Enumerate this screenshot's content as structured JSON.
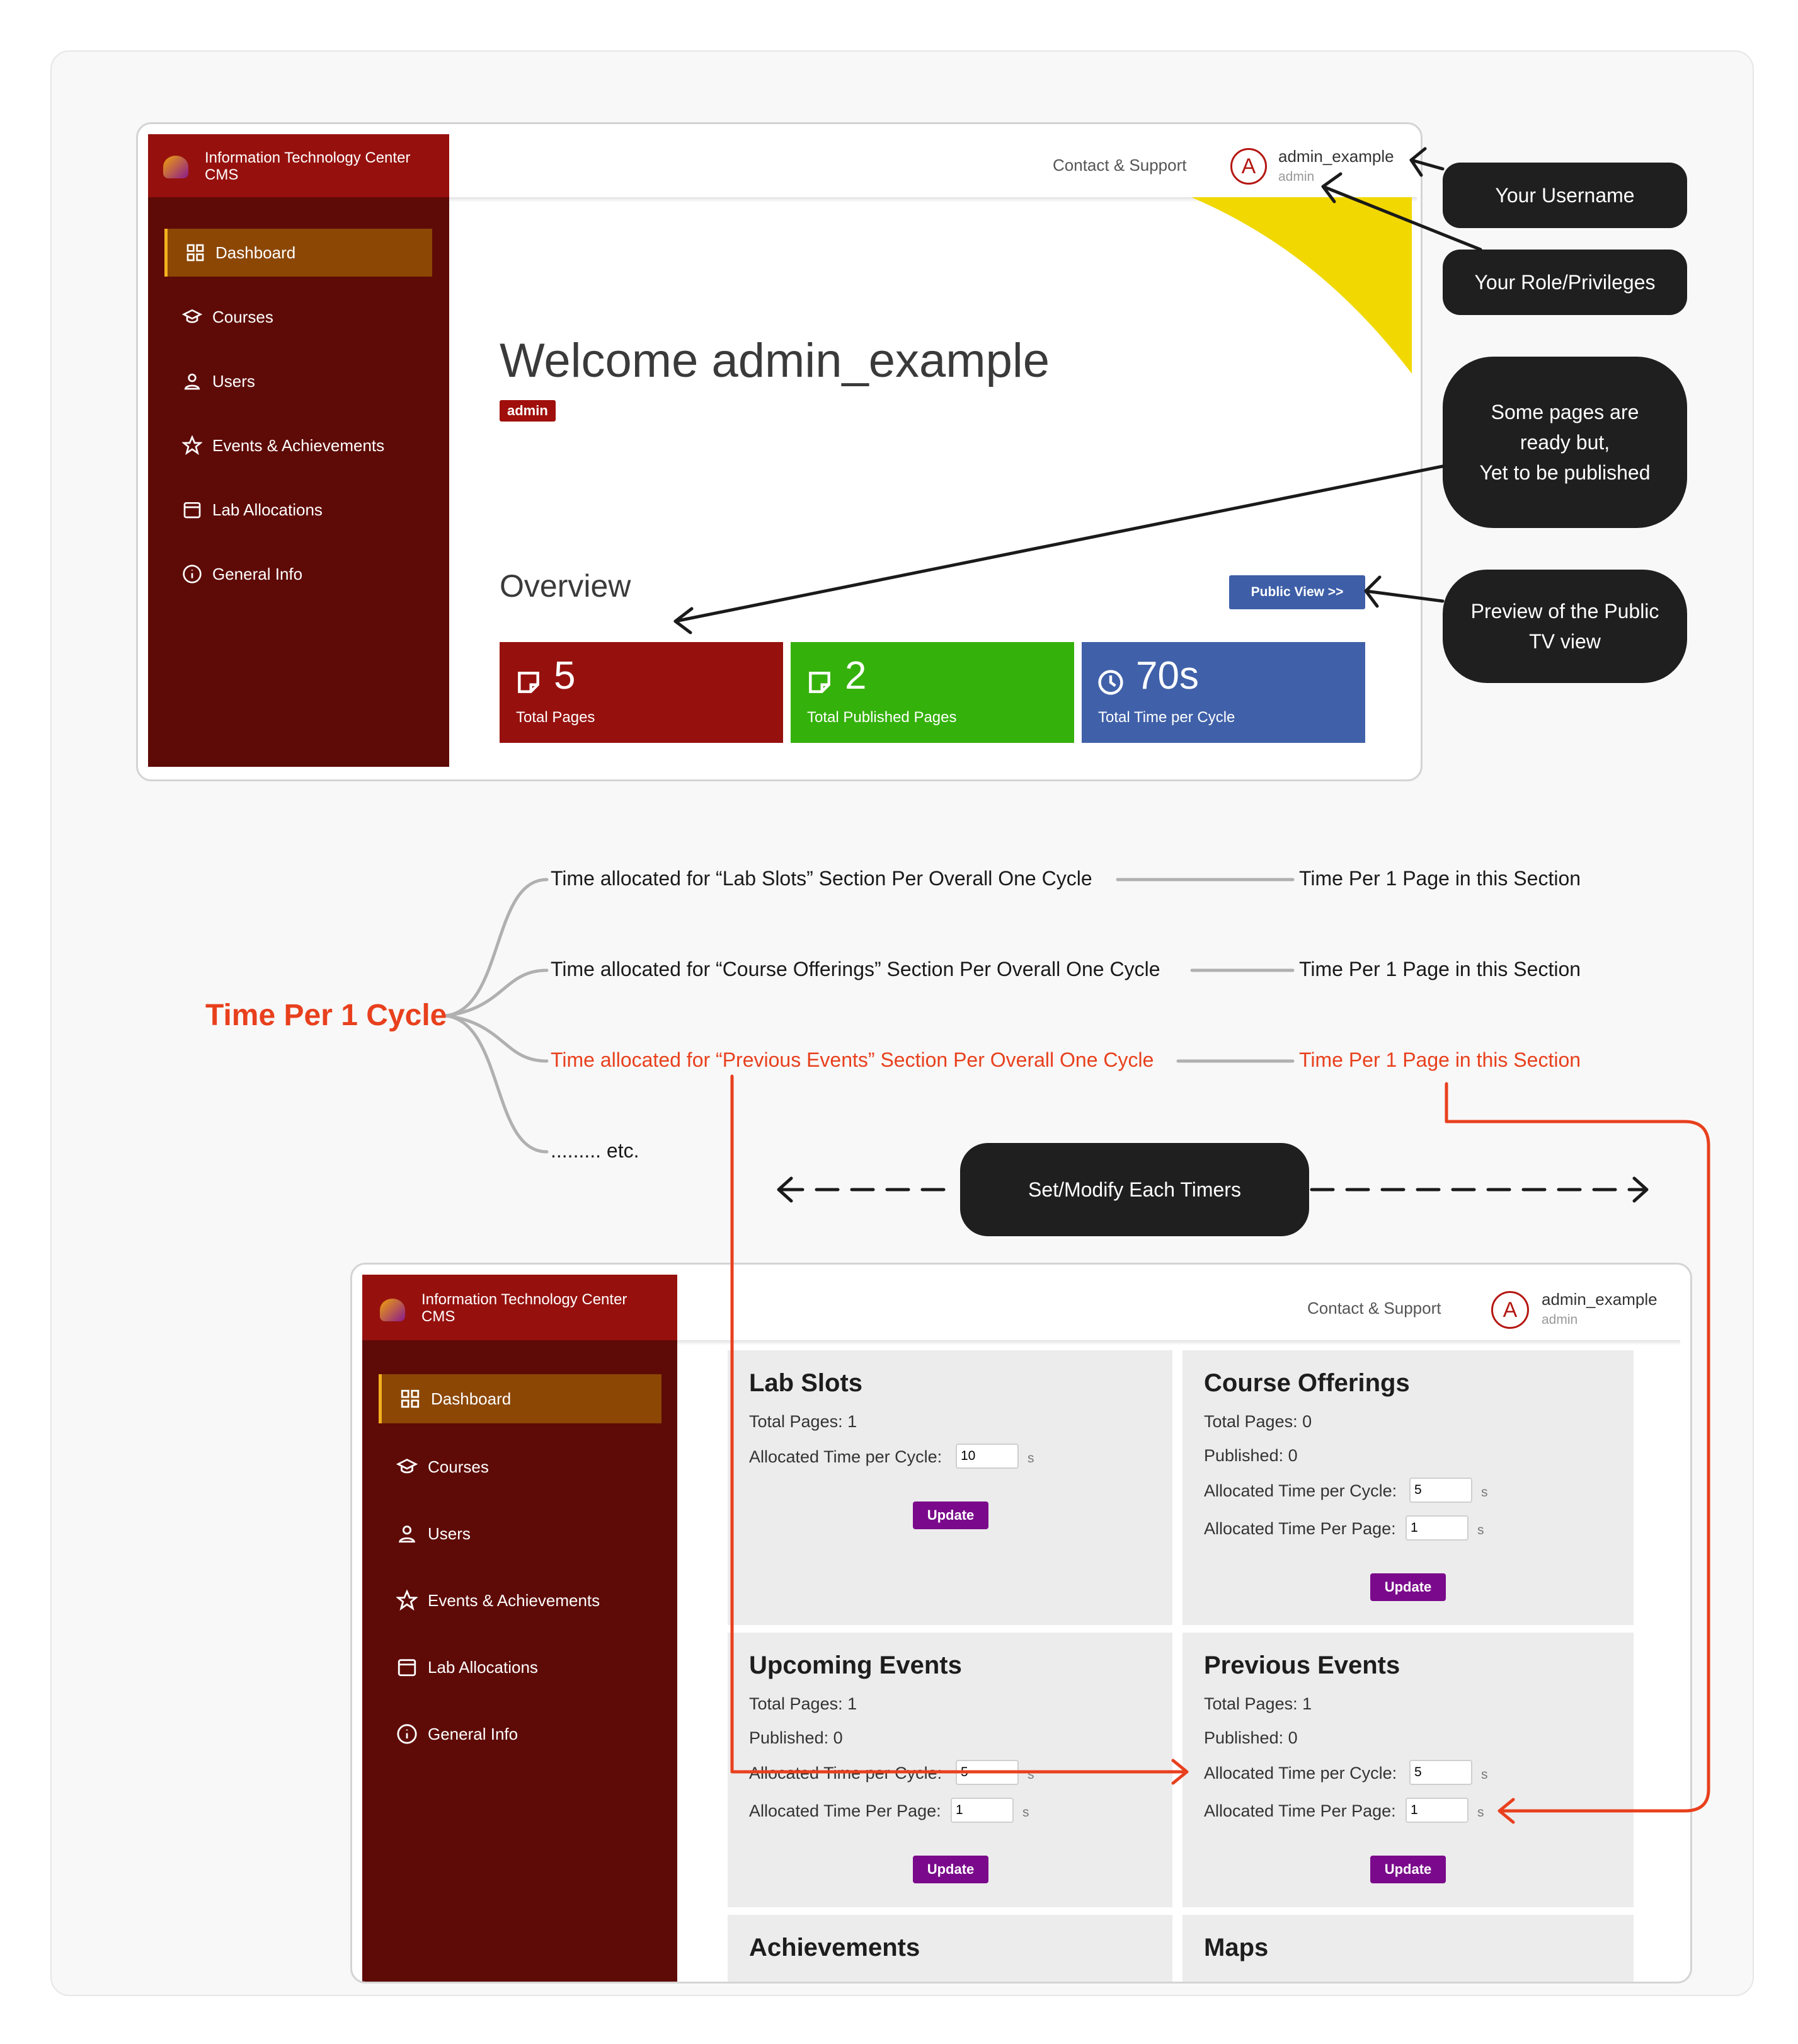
{
  "app": {
    "brand_line1": "Information Technology Center",
    "brand_line2": "CMS",
    "contact": "Contact & Support",
    "username": "admin_example",
    "role": "admin",
    "avatar_letter": "A",
    "nav": [
      {
        "label": "Dashboard",
        "icon": "dashboard-grid-icon"
      },
      {
        "label": "Courses",
        "icon": "graduation-cap-icon"
      },
      {
        "label": "Users",
        "icon": "user-icon"
      },
      {
        "label": "Events & Achievements",
        "icon": "star-icon"
      },
      {
        "label": "Lab Allocations",
        "icon": "calendar-icon"
      },
      {
        "label": "General Info",
        "icon": "info-icon"
      }
    ]
  },
  "dashboard": {
    "welcome": "Welcome admin_example",
    "badge": "admin",
    "overview": "Overview",
    "public_view": "Public View  >>",
    "stats": [
      {
        "value": "5",
        "label": "Total Pages",
        "color": "#96110e",
        "icon": "page-icon"
      },
      {
        "value": "2",
        "label": "Total Published Pages",
        "color": "#35b10b",
        "icon": "page-icon"
      },
      {
        "value": "70s",
        "label": "Total Time per Cycle",
        "color": "#4061a9",
        "icon": "clock-icon"
      }
    ]
  },
  "callouts": {
    "username": "Your Username",
    "role": "Your Role/Privileges",
    "pages_l1": "Some pages are",
    "pages_l2": "ready but,",
    "pages_l3": "Yet to be published",
    "preview_l1": "Preview of the Public",
    "preview_l2": "TV view",
    "timers": "Set/Modify Each Timers"
  },
  "mindmap": {
    "root": "Time Per 1 Cycle",
    "branches": [
      {
        "left": "Time allocated for “Lab Slots” Section Per Overall One Cycle",
        "right": "Time Per 1 Page in this Section"
      },
      {
        "left": "Time allocated for “Course Offerings” Section Per Overall One Cycle",
        "right": "Time Per 1 Page in this Section"
      },
      {
        "left": "Time allocated for “Previous Events” Section Per Overall One Cycle",
        "right": "Time Per 1 Page in this Section"
      }
    ],
    "etc": "......... etc.",
    "highlight_color": "#e8401d"
  },
  "timers": {
    "total_pages": "Total Pages:",
    "published": "Published:",
    "alloc_cycle": "Allocated Time per Cycle:",
    "alloc_page": "Allocated Time Per Page:",
    "unit": "s",
    "update": "Update",
    "cards": [
      {
        "title": "Lab Slots",
        "total_pages": "1",
        "cycle": "10"
      },
      {
        "title": "Course Offerings",
        "total_pages": "0",
        "published": "0",
        "cycle": "5",
        "page": "1"
      },
      {
        "title": "Upcoming Events",
        "total_pages": "1",
        "published": "0",
        "cycle": "5",
        "page": "1"
      },
      {
        "title": "Previous Events",
        "total_pages": "1",
        "published": "0",
        "cycle": "5",
        "page": "1"
      },
      {
        "title": "Achievements"
      },
      {
        "title": "Maps"
      }
    ]
  }
}
